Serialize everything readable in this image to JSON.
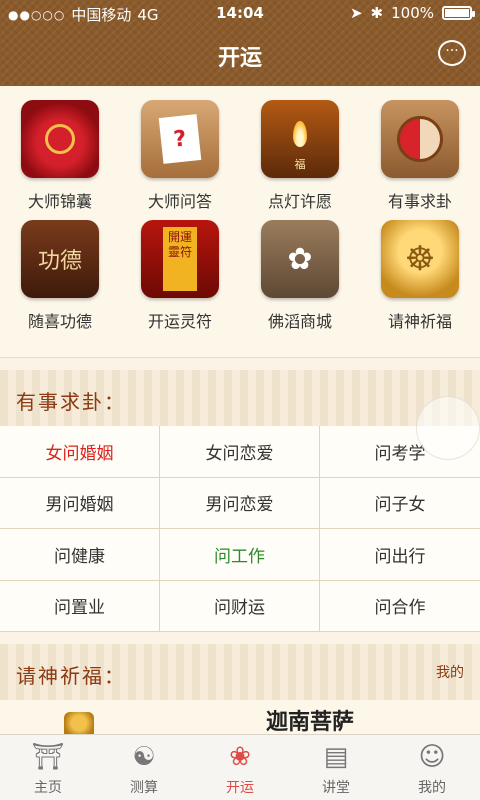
{
  "status": {
    "signal_dots": "●●○○○",
    "carrier": "中国移动",
    "network": "4G",
    "time": "14:04",
    "battery": "100%"
  },
  "header": {
    "title": "开运"
  },
  "grid": {
    "items": [
      {
        "label": "大师锦囊",
        "icon": "lucky-bag-icon"
      },
      {
        "label": "大师问答",
        "icon": "question-card-icon"
      },
      {
        "label": "点灯许愿",
        "icon": "lamp-icon"
      },
      {
        "label": "有事求卦",
        "icon": "divination-icon"
      },
      {
        "label": "随喜功德",
        "icon": "merit-box-icon"
      },
      {
        "label": "开运灵符",
        "icon": "talisman-icon"
      },
      {
        "label": "佛滔商城",
        "icon": "lotus-shop-icon"
      },
      {
        "label": "请神祈福",
        "icon": "buddha-icon"
      }
    ],
    "icon_text": {
      "lamp_char": "福",
      "merit_chars": "功德",
      "talisman_chars": "開運靈符"
    }
  },
  "divination": {
    "title": "有事求卦：",
    "cells": [
      {
        "label": "女问婚姻",
        "state": "red"
      },
      {
        "label": "女问恋爱",
        "state": "normal"
      },
      {
        "label": "问考学",
        "state": "normal"
      },
      {
        "label": "男问婚姻",
        "state": "normal"
      },
      {
        "label": "男问恋爱",
        "state": "normal"
      },
      {
        "label": "问子女",
        "state": "normal"
      },
      {
        "label": "问健康",
        "state": "normal"
      },
      {
        "label": "问工作",
        "state": "green"
      },
      {
        "label": "问出行",
        "state": "normal"
      },
      {
        "label": "问置业",
        "state": "normal"
      },
      {
        "label": "问财运",
        "state": "normal"
      },
      {
        "label": "问合作",
        "state": "normal"
      }
    ]
  },
  "pray": {
    "title": "请神祈福：",
    "more": "我的",
    "deity_name": "迦南菩萨"
  },
  "tabbar": {
    "tabs": [
      {
        "label": "主页",
        "icon": "temple-icon"
      },
      {
        "label": "测算",
        "icon": "yin-yang-icon"
      },
      {
        "label": "开运",
        "icon": "lotus-icon"
      },
      {
        "label": "讲堂",
        "icon": "book-icon"
      },
      {
        "label": "我的",
        "icon": "monk-icon"
      }
    ],
    "active_index": 2
  },
  "colors": {
    "header_brown": "#8a5a2b",
    "accent_red": "#e04a45",
    "section_title": "#8b3a12",
    "highlight_red": "#d9231c",
    "highlight_green": "#2b8a2b"
  }
}
